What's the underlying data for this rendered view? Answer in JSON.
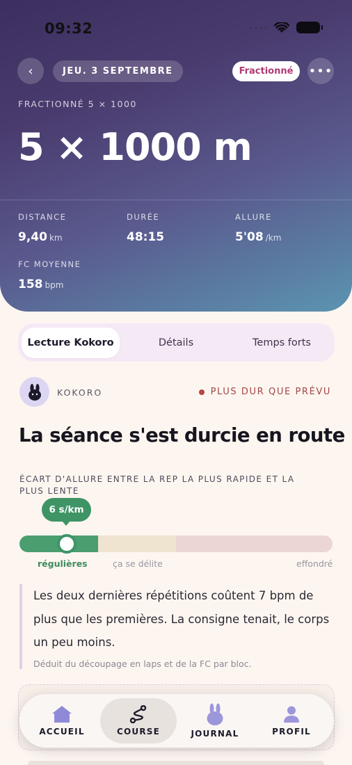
{
  "status_bar": {
    "time": "09:32"
  },
  "header": {
    "date": "JEU. 3 SEPTEMBRE",
    "type_badge": "Fractionné",
    "subtitle": "FRACTIONNÉ 5 × 1000",
    "title": "5 × 1000 m",
    "back_icon": "chevron-left-icon",
    "more_icon": "more-horizontal-icon"
  },
  "stats": [
    {
      "label": "DISTANCE",
      "value": "9,40",
      "unit": "km"
    },
    {
      "label": "DURÉE",
      "value": "48:15",
      "unit": ""
    },
    {
      "label": "ALLURE",
      "value": "5'08",
      "unit": "/km"
    },
    {
      "label": "FC MOYENNE",
      "value": "158",
      "unit": "bpm"
    }
  ],
  "tabs": [
    {
      "label": "Lecture Kokoro",
      "active": true
    },
    {
      "label": "Détails",
      "active": false
    },
    {
      "label": "Temps forts",
      "active": false
    }
  ],
  "kokoro": {
    "name": "KOKORO",
    "verdict": "PLUS DUR QUE PRÉVU",
    "verdict_color": "#b84545",
    "headline": "La séance s'est durcie en route"
  },
  "metric": {
    "label": "ÉCART D'ALLURE ENTRE LA REP LA PLUS RAPIDE ET LA PLUS LENTE",
    "value": "6 s/km",
    "position": 0.15,
    "scale_labels": [
      "régulières",
      "ça se délite",
      "effondré"
    ],
    "colors": {
      "good": "#4a9e6f",
      "mid": "#efe4cf",
      "bad": "#ecd6d4"
    }
  },
  "insight": {
    "text": "Les deux dernières répétitions coûtent 7 bpm de plus que les premières. La consigne tenait, le corps un peu moins.",
    "note": "Déduit du découpage en laps et de la FC par bloc."
  },
  "nav": [
    {
      "label": "ACCUEIL",
      "icon": "home-icon",
      "active": false
    },
    {
      "label": "COURSE",
      "icon": "route-icon",
      "active": true
    },
    {
      "label": "JOURNAL",
      "icon": "bunny-icon",
      "active": false
    },
    {
      "label": "PROFIL",
      "icon": "person-icon",
      "active": false
    }
  ]
}
